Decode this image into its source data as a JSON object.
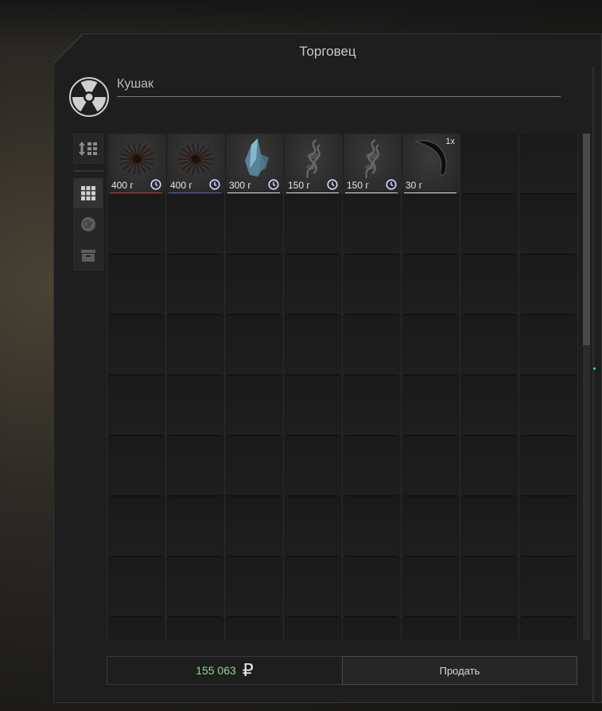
{
  "window": {
    "title": "Торговец"
  },
  "trader": {
    "name": "Кушак",
    "icon": "radiation-icon"
  },
  "sidebar": {
    "buttons": [
      {
        "name": "sort-icon",
        "active": false
      },
      {
        "name": "grid-view-icon",
        "active": true
      },
      {
        "name": "artifact-filter-icon",
        "active": false
      },
      {
        "name": "container-icon",
        "active": false
      }
    ]
  },
  "inventory": {
    "columns": 8,
    "rows": 9,
    "items": [
      {
        "name": "spiky-artifact",
        "weight": "400 г",
        "timer": true,
        "accent": "#c0303a"
      },
      {
        "name": "spiky-artifact",
        "weight": "400 г",
        "timer": true,
        "accent": "#5a5ab8"
      },
      {
        "name": "crystal-artifact",
        "weight": "300 г",
        "timer": true,
        "accent": "#d8d8d8"
      },
      {
        "name": "smoke-artifact",
        "weight": "150 г",
        "timer": true,
        "accent": "#d8d8d8"
      },
      {
        "name": "smoke-artifact",
        "weight": "150 г",
        "timer": true,
        "accent": "#d8d8d8"
      },
      {
        "name": "claw-item",
        "weight": "30 г",
        "timer": false,
        "count": "1x",
        "accent": "#d8d8d8"
      }
    ]
  },
  "footer": {
    "money": "155 063",
    "currency": "₽",
    "sell_label": "Продать"
  },
  "colors": {
    "money": "#8fd48f",
    "background": "#1e1e1e"
  }
}
